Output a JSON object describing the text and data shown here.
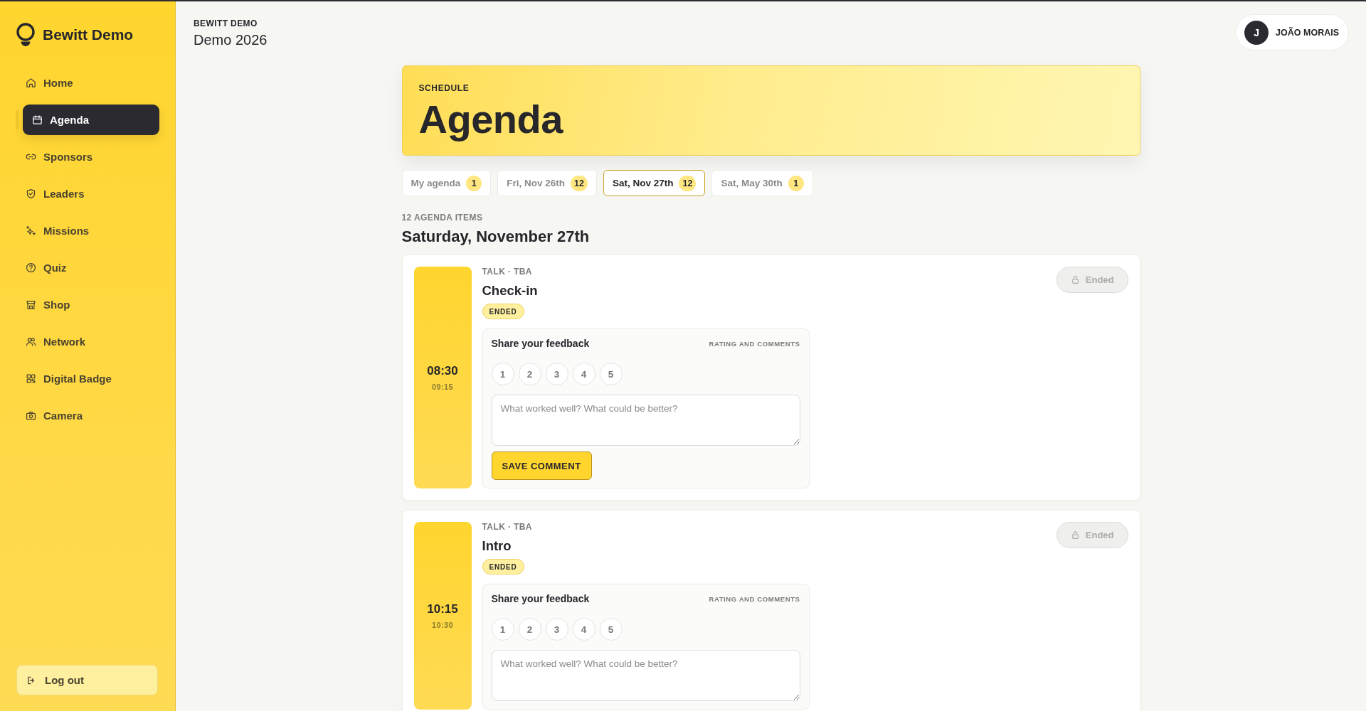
{
  "sidebar": {
    "brand": "Bewitt Demo",
    "nav": [
      {
        "label": "Home",
        "selected": false
      },
      {
        "label": "Agenda",
        "selected": true
      },
      {
        "label": "Sponsors",
        "selected": false
      },
      {
        "label": "Leaders",
        "selected": false
      },
      {
        "label": "Missions",
        "selected": false
      },
      {
        "label": "Quiz",
        "selected": false
      },
      {
        "label": "Shop",
        "selected": false
      },
      {
        "label": "Network",
        "selected": false
      },
      {
        "label": "Digital Badge",
        "selected": false
      },
      {
        "label": "Camera",
        "selected": false
      }
    ],
    "logout": "Log out"
  },
  "header": {
    "event": "BEWITT DEMO",
    "title": "Demo 2026"
  },
  "user": {
    "initial": "J",
    "name": "JOÃO MORAIS"
  },
  "hero": {
    "eyebrow": "SCHEDULE",
    "title": "Agenda"
  },
  "tabs": [
    {
      "label": "My agenda",
      "count": "1",
      "selected": false
    },
    {
      "label": "Fri, Nov 26th",
      "count": "12",
      "selected": false
    },
    {
      "label": "Sat, Nov 27th",
      "count": "12",
      "selected": true
    },
    {
      "label": "Sat, May 30th",
      "count": "1",
      "selected": false
    }
  ],
  "day": {
    "count": "12 AGENDA ITEMS",
    "title": "Saturday, November 27th"
  },
  "items": [
    {
      "start": "08:30",
      "end": "09:15",
      "meta": "TALK · TBA",
      "title": "Check-in",
      "status": "ENDED",
      "action": {
        "label": "Ended",
        "disabled": true
      },
      "feedback": {
        "title": "Share your feedback",
        "hint": "RATING AND COMMENTS",
        "ratings": [
          {
            "label": "1",
            "selected": false
          },
          {
            "label": "2",
            "selected": false
          },
          {
            "label": "3",
            "selected": false
          },
          {
            "label": "4",
            "selected": false
          },
          {
            "label": "5",
            "selected": false
          }
        ],
        "placeholder": "What worked well? What could be better?",
        "save_button": "SAVE COMMENT"
      }
    },
    {
      "start": "10:15",
      "end": "10:30",
      "meta": "TALK · TBA",
      "title": "Intro",
      "status": "ENDED",
      "action": {
        "label": "Ended",
        "disabled": true
      },
      "feedback": {
        "title": "Share your feedback",
        "hint": "RATING AND COMMENTS",
        "ratings": [
          {
            "label": "1",
            "selected": false
          },
          {
            "label": "2",
            "selected": false
          },
          {
            "label": "3",
            "selected": false
          },
          {
            "label": "4",
            "selected": false
          },
          {
            "label": "5",
            "selected": false
          }
        ],
        "placeholder": "What worked well? What could be better?"
      }
    }
  ]
}
